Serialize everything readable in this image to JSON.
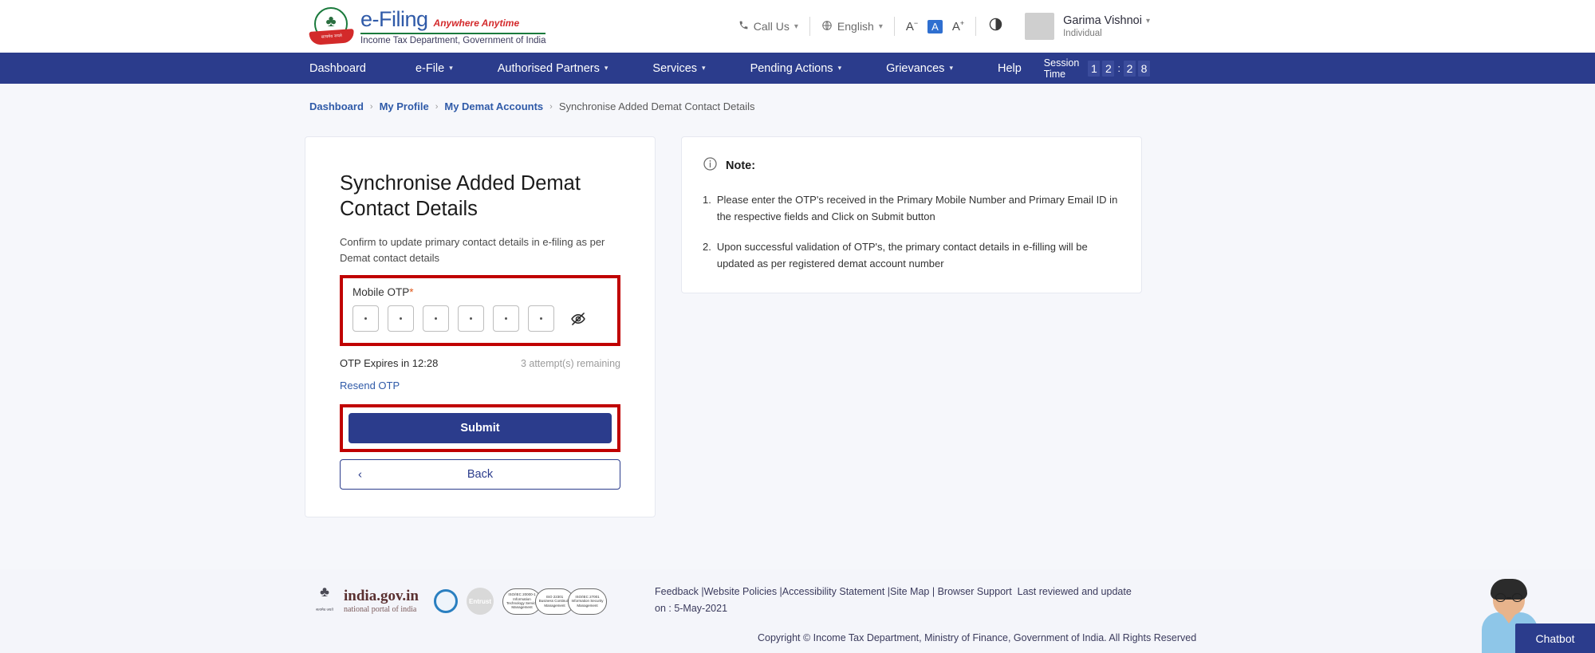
{
  "header": {
    "brand": {
      "name": "e-Filing",
      "tagline": "Anywhere Anytime",
      "department": "Income Tax Department, Government of India",
      "emblem_caption": "सत्यमेव जयते"
    },
    "call_us": "Call Us",
    "language": "English",
    "font_decrease": "A",
    "font_normal": "A",
    "font_increase": "A",
    "user": {
      "name": "Garima Vishnoi",
      "role": "Individual"
    }
  },
  "nav": {
    "items": [
      {
        "label": "Dashboard",
        "has_caret": false
      },
      {
        "label": "e-File",
        "has_caret": true
      },
      {
        "label": "Authorised Partners",
        "has_caret": true
      },
      {
        "label": "Services",
        "has_caret": true
      },
      {
        "label": "Pending Actions",
        "has_caret": true
      },
      {
        "label": "Grievances",
        "has_caret": true
      },
      {
        "label": "Help",
        "has_caret": false
      }
    ],
    "session_label": "Session Time",
    "session_digits": [
      "1",
      "2",
      "2",
      "8"
    ],
    "session_colon": ":"
  },
  "breadcrumb": {
    "items": [
      "Dashboard",
      "My Profile",
      "My Demat Accounts"
    ],
    "current": "Synchronise Added Demat Contact Details",
    "separator": "›"
  },
  "card": {
    "title": "Synchronise Added Demat Contact Details",
    "subtitle": "Confirm to update primary contact details in e-filing as per Demat contact details",
    "otp_label": "Mobile OTP",
    "otp_required_mark": "*",
    "otp_boxes": [
      "•",
      "•",
      "•",
      "•",
      "•",
      "•"
    ],
    "otp_box_count": 6,
    "toggle_visibility_icon": "eye-off-icon",
    "expires_text": "OTP Expires in 12:28",
    "attempts_text": "3 attempt(s) remaining",
    "resend_label": "Resend OTP",
    "submit_label": "Submit",
    "back_label": "Back",
    "back_chevron": "‹"
  },
  "note": {
    "title": "Note:",
    "icon": "info-icon",
    "items": [
      {
        "num": "1.",
        "text": "Please enter the OTP's received in the Primary Mobile Number and Primary Email ID in the respective fields and Click on Submit button"
      },
      {
        "num": "2.",
        "text": "Upon successful validation of OTP's, the primary contact details in e-filling will be updated as per registered demat account number"
      }
    ]
  },
  "footer": {
    "india_gov": "india.gov.in",
    "india_gov_sub": "national portal of india",
    "entrust": "Entrust",
    "certs": [
      "ISO/IEC 20000-1 Information Technology Service Management",
      "ISO 22301 Business Continuity Management",
      "ISO/IEC 27001 Information Security Management"
    ],
    "links": "Feedback |Website Policies |Accessibility Statement |Site Map | Browser Support",
    "last_reviewed": "Last reviewed and update on : 5-May-2021",
    "copyright": "Copyright © Income Tax Department, Ministry of Finance, Government of India. All Rights Reserved"
  },
  "chatbot": {
    "label": "Chatbot"
  },
  "colors": {
    "nav_blue": "#2b3c8c",
    "link_blue": "#2f5aa8",
    "highlight_red": "#c00000",
    "page_bg": "#f6f7fb",
    "accent_green": "#1a7a3c",
    "brand_red": "#d3292b"
  }
}
